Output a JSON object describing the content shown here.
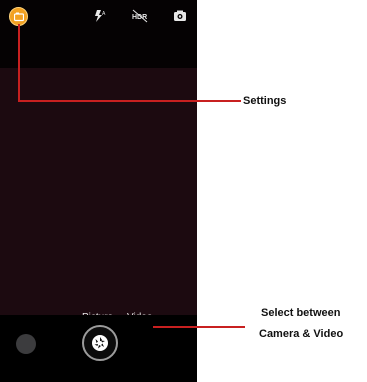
{
  "camera": {
    "top_icons": [
      "settings-icon",
      "flash-auto-icon",
      "hdr-off-icon",
      "switch-camera-icon"
    ],
    "modes": {
      "picture_label": "Picture",
      "video_label": "Video"
    },
    "bottom_icons": [
      "gallery-thumbnail",
      "shutter-icon"
    ]
  },
  "annotations": {
    "settings_label": "Settings",
    "select_line1": "Select between",
    "select_line2": "Camera & Video"
  },
  "colors": {
    "settings_accent": "#f2a122",
    "callout_line": "#c82020",
    "viewfinder": "#1c0a10"
  }
}
